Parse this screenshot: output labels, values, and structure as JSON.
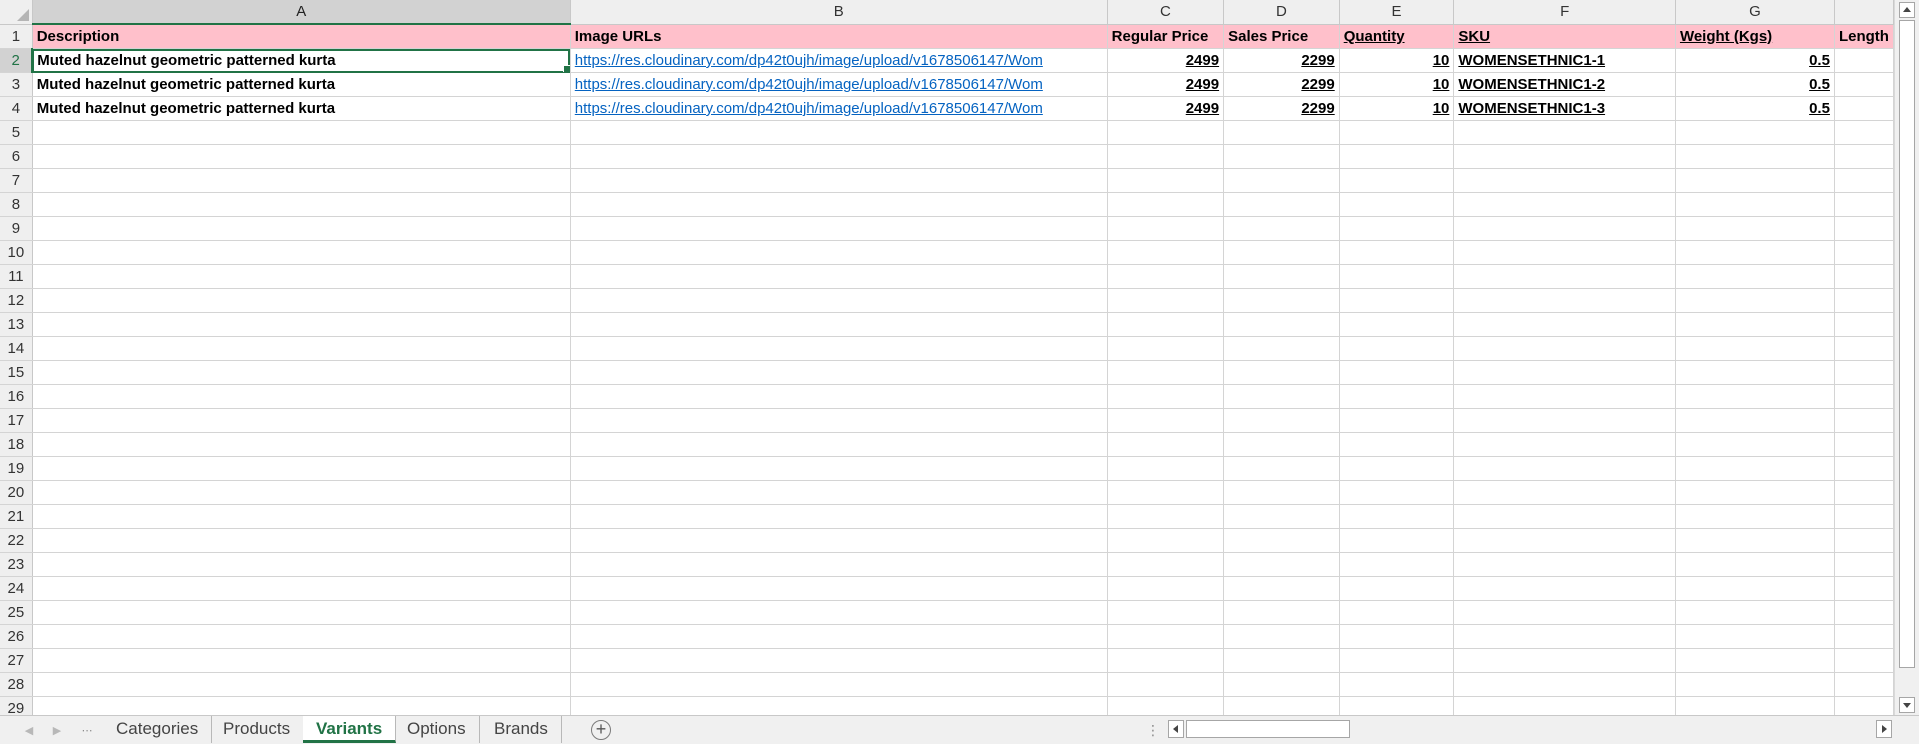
{
  "columns": [
    "A",
    "B",
    "C",
    "D",
    "E",
    "F",
    "G",
    ""
  ],
  "active_column": "A",
  "active_row": "2",
  "header_row": {
    "A": "Description",
    "B": "Image URLs",
    "C": "Regular Price",
    "D": "Sales Price",
    "E": "Quantity",
    "F": "SKU",
    "G": "Weight (Kgs)",
    "H": "Length"
  },
  "rows": [
    {
      "num": "2",
      "description": "Muted hazelnut geometric patterned kurta",
      "image_url": "https://res.cloudinary.com/dp42t0ujh/image/upload/v1678506147/Wom",
      "regular_price": "2499",
      "sales_price": "2299",
      "quantity": "10",
      "sku": "WOMENSETHNIC1-1",
      "weight": "0.5"
    },
    {
      "num": "3",
      "description": "Muted hazelnut geometric patterned kurta",
      "image_url": "https://res.cloudinary.com/dp42t0ujh/image/upload/v1678506147/Wom",
      "regular_price": "2499",
      "sales_price": "2299",
      "quantity": "10",
      "sku": "WOMENSETHNIC1-2",
      "weight": "0.5"
    },
    {
      "num": "4",
      "description": "Muted hazelnut geometric patterned kurta",
      "image_url": "https://res.cloudinary.com/dp42t0ujh/image/upload/v1678506147/Wom",
      "regular_price": "2499",
      "sales_price": "2299",
      "quantity": "10",
      "sku": "WOMENSETHNIC1-3",
      "weight": "0.5"
    }
  ],
  "empty_row_numbers": [
    "5",
    "6",
    "7",
    "8",
    "9",
    "10",
    "11",
    "12",
    "13",
    "14",
    "15",
    "16",
    "17",
    "18",
    "19",
    "20",
    "21",
    "22",
    "23",
    "24",
    "25",
    "26",
    "27",
    "28",
    "29"
  ],
  "sheet_tabs": [
    {
      "label": "Categories",
      "active": false
    },
    {
      "label": "Products",
      "active": false
    },
    {
      "label": "Variants",
      "active": true
    },
    {
      "label": "Options",
      "active": false
    },
    {
      "label": "Brands",
      "active": false
    }
  ],
  "add_sheet_symbol": "+",
  "colors": {
    "header_fill": "#ffc0cb",
    "accent": "#217346",
    "link": "#0563c1"
  }
}
